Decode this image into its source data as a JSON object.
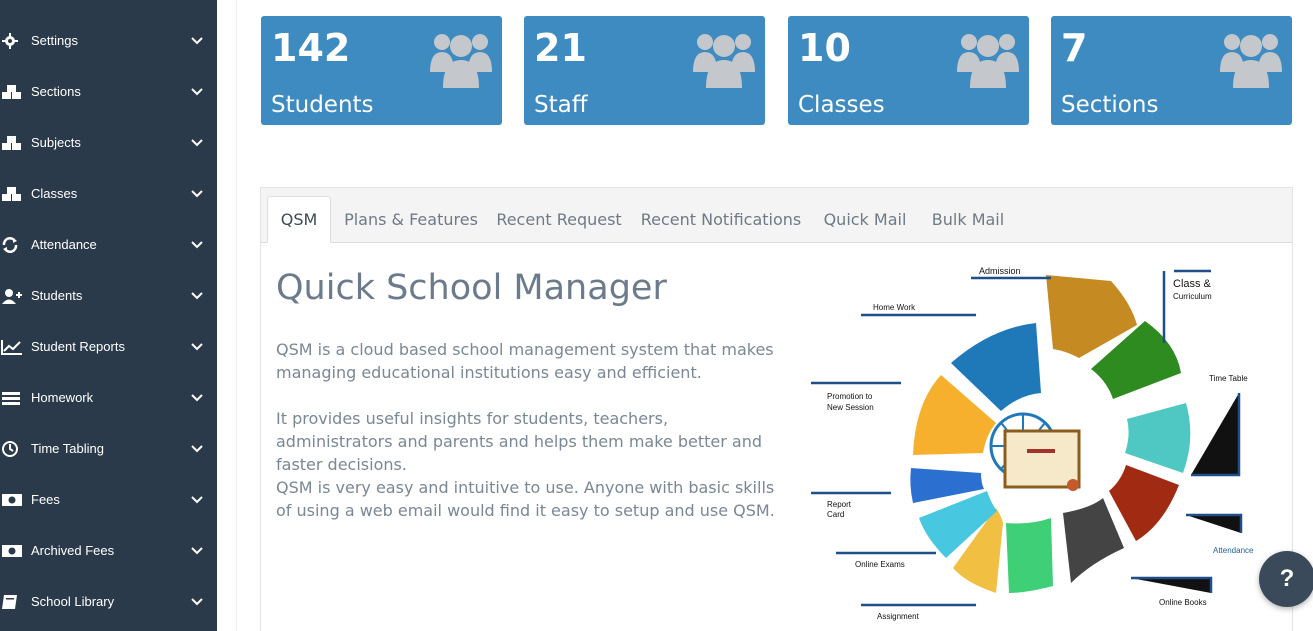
{
  "sidebar": {
    "items": [
      {
        "label": "Settings",
        "icon": "gear-icon"
      },
      {
        "label": "Sections",
        "icon": "cubes-icon"
      },
      {
        "label": "Subjects",
        "icon": "cubes-icon"
      },
      {
        "label": "Classes",
        "icon": "cubes-icon"
      },
      {
        "label": "Attendance",
        "icon": "refresh-icon"
      },
      {
        "label": "Students",
        "icon": "user-plus-icon"
      },
      {
        "label": "Student Reports",
        "icon": "line-chart-icon"
      },
      {
        "label": "Homework",
        "icon": "list-icon"
      },
      {
        "label": "Time Tabling",
        "icon": "clock-icon"
      },
      {
        "label": "Fees",
        "icon": "money-icon"
      },
      {
        "label": "Archived Fees",
        "icon": "money-icon"
      },
      {
        "label": "School Library",
        "icon": "book-icon"
      }
    ]
  },
  "stats": [
    {
      "value": "142",
      "label": "Students"
    },
    {
      "value": "21",
      "label": "Staff"
    },
    {
      "value": "10",
      "label": "Classes"
    },
    {
      "value": "7",
      "label": "Sections"
    }
  ],
  "tabs": [
    "QSM",
    "Plans & Features",
    "Recent Request",
    "Recent Notifications",
    "Quick Mail",
    "Bulk Mail"
  ],
  "content": {
    "title": "Quick School Manager",
    "p1": "QSM is a cloud based school management system that makes managing educational institutions easy and efficient.",
    "p2": "It provides useful insights for students, teachers, administrators and parents and helps them make better and faster decisions.",
    "p3": "QSM is very easy and intuitive to use. Anyone with basic skills of using a web email would find it easy to setup and use QSM."
  },
  "wheel_labels": {
    "admission": "Admission",
    "class": "Class &",
    "curriculum": "Curriculum",
    "homework": "Home Work",
    "timetable": "Time Table",
    "promotion1": "Promotion to",
    "promotion2": "New Session",
    "report1": "Report",
    "report2": "Card",
    "attendance": "Attendance",
    "exams": "Online Exams",
    "books": "Online Books",
    "assignment": "Assignment"
  },
  "help": "?",
  "colors": {
    "sidebar": "#2b3a4a",
    "stat": "#3d8bc0",
    "accent": "#3d8bc0"
  }
}
